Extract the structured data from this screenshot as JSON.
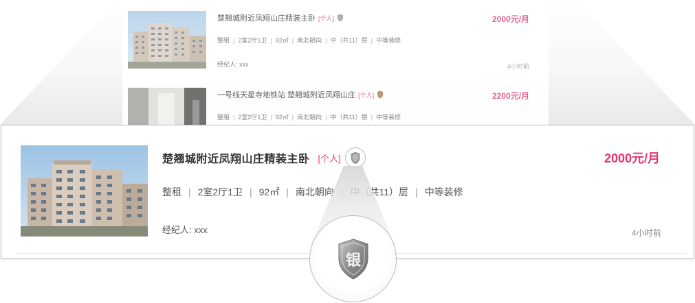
{
  "listings_preview": [
    {
      "title": "楚翘城附近凤翔山庄精装主卧",
      "tag": "[个人]",
      "badge_icon": "silver-shield-badge-icon",
      "price": "2000元/月",
      "meta": [
        "整租",
        "2室2厅1卫",
        "92㎡",
        "南北朝向",
        "中（共11）层",
        "中等装修"
      ],
      "agent": "经纪人: xxx",
      "time": "4小时前"
    },
    {
      "title": "一号线天星寺地铁站 楚翘城附近凤翔山庄",
      "tag": "[个人]",
      "badge_icon": "bronze-shield-badge-icon",
      "price": "2200元/月",
      "meta": [
        "整租",
        "2室2厅1卫",
        "92㎡",
        "南北朝向",
        "中（共11）层",
        "中等装修"
      ]
    }
  ],
  "zoomed_listing": {
    "title": "楚翘城附近凤翔山庄精装主卧",
    "tag": "[个人]",
    "badge_icon": "silver-shield-badge-icon",
    "price": "2000元/月",
    "meta": [
      "整租",
      "2室2厅1卫",
      "92㎡",
      "南北朝向",
      "中（共11）层",
      "中等装修"
    ],
    "agent": "经纪人: xxx",
    "time": "4小时前"
  },
  "magnifier": {
    "badge_icon": "silver-shield-badge-icon",
    "badge_text": "银"
  },
  "colors": {
    "accent": "#e8336f",
    "silver": "#8f8f8f",
    "bronze": "#b0784a"
  }
}
